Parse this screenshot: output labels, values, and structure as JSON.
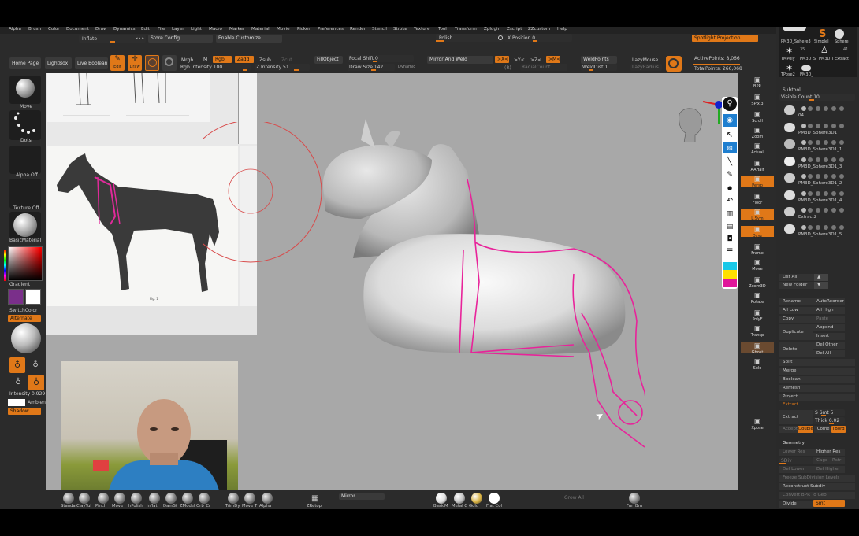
{
  "menu": [
    "Alpha",
    "Brush",
    "Color",
    "Document",
    "Draw",
    "Dynamics",
    "Edit",
    "File",
    "Layer",
    "Light",
    "Macro",
    "Marker",
    "Material",
    "Movie",
    "Picker",
    "Preferences",
    "Render",
    "Stencil",
    "Stroke",
    "Texture",
    "Tool",
    "Transform",
    "Zplugin",
    "Zscript",
    "ZZcustom",
    "Help"
  ],
  "toolbar": {
    "inflate": "Inflate",
    "store_config": "Store Config",
    "enable_customize": "Enable Customize",
    "polish": "Polish",
    "x_position": "X Position 0",
    "spotlight": "Spotlight Projection",
    "home_page": "Home Page",
    "lightbox": "LightBox",
    "live_boolean": "Live Boolean",
    "edit": "Edit",
    "draw": "Draw",
    "mrgb": "Mrgb",
    "m": "M",
    "rgb": "Rgb",
    "zadd": "Zadd",
    "zsub": "Zsub",
    "zcut": "Zcut",
    "rgb_intensity": "Rgb Intensity 100",
    "z_intensity": "Z Intensity 51",
    "fill_object": "FillObject",
    "focal_shift": "Focal Shift 0",
    "draw_size": "Draw Size 142",
    "dynamic": "Dynamic",
    "mirror_weld": "Mirror And Weld",
    "x_sym": ">X<",
    "y_sym": ">Y<",
    "z_sym": ">Z<",
    "m_sym": ">M<",
    "r": "(R)",
    "radial_count": "RadialCount",
    "weld_points": "WeldPoints",
    "weld_dist": "WeldDist 1",
    "lazy_mouse": "LazyMouse",
    "lazy_radius": "LazyRadius",
    "active_points": "ActivePoints: 8,066",
    "total_points": "TotalPoints: 266,068"
  },
  "left": {
    "move": "Move",
    "dots": "Dots",
    "alpha_off": "Alpha Off",
    "texture_off": "Texture Off",
    "material": "BasicMaterial",
    "gradient": "Gradient",
    "switch_color": "SwitchColor",
    "alternate": "Alternate",
    "intensity": "Intensity 0.929",
    "ambient": "Ambient 4",
    "shadow": "Shadow",
    "primary_color": "#7a2f8a",
    "secondary_color": "#ffffff"
  },
  "right_shelf": [
    {
      "icon": "bpr-icon",
      "label": "BPR"
    },
    {
      "icon": "spix-icon",
      "label": "SPix 3"
    },
    {
      "icon": "scroll-icon",
      "label": "Scroll"
    },
    {
      "icon": "zoom-icon",
      "label": "Zoom"
    },
    {
      "icon": "actual-icon",
      "label": "Actual"
    },
    {
      "icon": "aahalf-icon",
      "label": "AAHalf"
    },
    {
      "icon": "persp-icon",
      "label": "Persp"
    },
    {
      "icon": "floor-icon",
      "label": "Floor"
    },
    {
      "icon": "lsym-icon",
      "label": "L.Sym"
    },
    {
      "icon": "qxyz-icon",
      "label": "Qxyz"
    },
    {
      "icon": "frame-icon",
      "label": "Frame"
    },
    {
      "icon": "move-icon",
      "label": "Move"
    },
    {
      "icon": "zoom3d-icon",
      "label": "Zoom3D"
    },
    {
      "icon": "rotate-icon",
      "label": "Rotate"
    },
    {
      "icon": "polyf-icon",
      "label": "PolyF"
    },
    {
      "icon": "transp-icon",
      "label": "Transp"
    },
    {
      "icon": "ghost-icon",
      "label": "Ghost"
    },
    {
      "icon": "solo-icon",
      "label": "Solo"
    },
    {
      "icon": "xpose-icon",
      "label": "Xpose"
    }
  ],
  "right_panel": {
    "thumb_labels": [
      "PM3D_Sphere3",
      "SimpleI",
      "Sphere",
      "TMPoly",
      "PM3D_S",
      "PM3D_I",
      "Extract",
      "TPose2",
      "PM3D_"
    ],
    "thumb_badges": [
      "41",
      "35"
    ],
    "subtool_title": "Subtool",
    "visible_count": "Visible Count 10",
    "subtools": [
      {
        "name": "04"
      },
      {
        "name": "PM3D_Sphere3D1"
      },
      {
        "name": "PM3D_Sphere3D1_1"
      },
      {
        "name": "PM3D_Sphere3D1_3"
      },
      {
        "name": "PM3D_Sphere3D1_2"
      },
      {
        "name": "PM3D_Sphere3D1_4"
      },
      {
        "name": "Extract2"
      },
      {
        "name": "PM3D_Sphere3D1_5"
      }
    ],
    "list_all": "List All",
    "new_folder": "New Folder",
    "rename": "Rename",
    "auto_reorder": "AutoReorder",
    "all_low": "All Low",
    "all_high": "All High",
    "copy": "Copy",
    "paste": "Paste",
    "duplicate": "Duplicate",
    "append": "Append",
    "insert": "Insert",
    "delete": "Delete",
    "del_other": "Del Other",
    "del_all": "Del All",
    "split": "Split",
    "merge": "Merge",
    "boolean": "Boolean",
    "remesh": "Remesh",
    "project": "Project",
    "extract_title": "Extract",
    "extract": "Extract",
    "s_smt": "S Smt 5",
    "thick": "Thick 0.02",
    "accept": "Accept",
    "double": "Double",
    "tcorne": "TCorne",
    "tbord": "TBord",
    "geometry_title": "Geometry",
    "lower_res": "Lower Res",
    "higher_res": "Higher Res",
    "sdiv": "SDiv",
    "cage": "Cage",
    "rstr": "Rstr",
    "del_lower": "Del Lower",
    "del_higher": "Del Higher",
    "freeze": "Freeze SubDivision Levels",
    "reconstruct": "Reconstruct Subdiv",
    "convert": "Convert BPR To Geo",
    "divide": "Divide",
    "smt": "Smt"
  },
  "bottom_brushes": [
    "Standar",
    "ClayTul",
    "Pinch",
    "Move",
    "hPolish",
    "Inflat",
    "DamSt",
    "ZModel",
    "Orb_Cr",
    "TrimDy",
    "Move T",
    "Alpha",
    "ZRetop"
  ],
  "bottom": {
    "mirror": "Mirror",
    "grow_all": "Grow All",
    "materials": [
      "BasicM",
      "Metal C",
      "Gold",
      "Flat Col"
    ],
    "fur": "Fur_Bru"
  }
}
